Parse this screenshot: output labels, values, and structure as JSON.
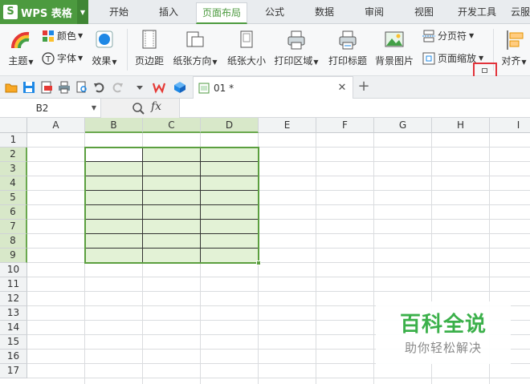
{
  "app": {
    "name": "WPS 表格"
  },
  "menu_tabs": [
    "开始",
    "插入",
    "页面布局",
    "公式",
    "数据",
    "审阅",
    "视图",
    "开发工具",
    "云服"
  ],
  "active_tab": "页面布局",
  "ribbon": {
    "theme": "主题",
    "colors": "颜色",
    "fonts": "字体",
    "effects": "效果",
    "margins": "页边距",
    "orientation": "纸张方向",
    "size": "纸张大小",
    "print_area": "打印区域",
    "print_titles": "打印标题",
    "background": "背景图片",
    "breaks": "分页符",
    "scale": "页面缩放",
    "align": "对齐"
  },
  "document_tab": {
    "name": "01 *"
  },
  "formula_bar": {
    "cell_ref": "B2",
    "fx_label": "fx"
  },
  "sheet": {
    "columns": [
      "A",
      "B",
      "C",
      "D",
      "E",
      "F",
      "G",
      "H",
      "I"
    ],
    "rows": [
      "1",
      "2",
      "3",
      "4",
      "5",
      "6",
      "7",
      "8",
      "9",
      "10",
      "11",
      "12",
      "13",
      "14",
      "15",
      "16",
      "17"
    ],
    "selected_range": "B2:D9"
  },
  "watermark": {
    "title": "百科全说",
    "subtitle": "助你轻松解决"
  },
  "colors": {
    "brand": "#4c9a3f",
    "selection_fill": "#e3f2d6",
    "highlight": "#e2333b"
  }
}
